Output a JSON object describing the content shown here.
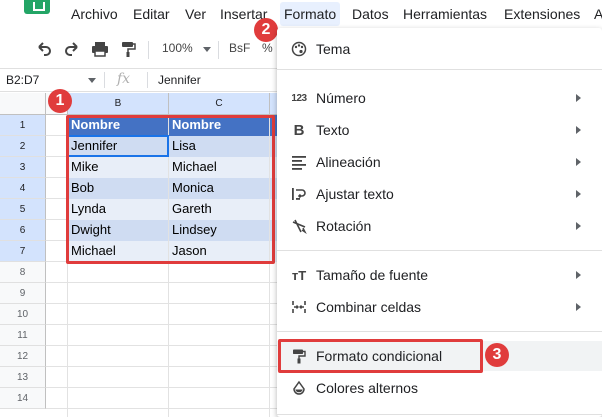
{
  "menubar": {
    "items": [
      {
        "label": "Archivo"
      },
      {
        "label": "Editar"
      },
      {
        "label": "Ver"
      },
      {
        "label": "Insertar"
      },
      {
        "label": "Formato"
      },
      {
        "label": "Datos"
      },
      {
        "label": "Herramientas"
      },
      {
        "label": "Extensiones"
      },
      {
        "label": "A"
      }
    ],
    "active_index": 4
  },
  "toolbar": {
    "zoom": "100%",
    "bsf": "BsF",
    "percent": "%",
    "icons": [
      "undo-icon",
      "redo-icon",
      "print-icon",
      "paint-format-icon"
    ]
  },
  "formula_bar": {
    "name_box": "B2:D7",
    "fx": "fx",
    "value": "Jennifer"
  },
  "grid": {
    "columns": [
      "B",
      "C"
    ],
    "rows": [
      "1",
      "2",
      "3",
      "4",
      "5",
      "6",
      "7",
      "8",
      "9",
      "10",
      "11",
      "12",
      "13",
      "14"
    ],
    "data": [
      [
        "Nombre",
        "Nombre"
      ],
      [
        "Jennifer",
        "Lisa"
      ],
      [
        "Mike",
        "Michael"
      ],
      [
        "Bob",
        "Monica"
      ],
      [
        "Lynda",
        "Gareth"
      ],
      [
        "Dwight",
        "Lindsey"
      ],
      [
        "Michael",
        "Jason"
      ]
    ],
    "header_color": "#4472c4",
    "band_dark": "#cfdcf2",
    "band_light": "#e8eef8"
  },
  "format_menu": {
    "items": [
      {
        "label": "Tema",
        "icon": "palette-icon",
        "submenu": false
      },
      {
        "label": "Número",
        "icon": "number-format-icon",
        "submenu": true
      },
      {
        "label": "Texto",
        "icon": "bold-icon",
        "submenu": true
      },
      {
        "label": "Alineación",
        "icon": "align-icon",
        "submenu": true
      },
      {
        "label": "Ajustar texto",
        "icon": "wrap-text-icon",
        "submenu": true
      },
      {
        "label": "Rotación",
        "icon": "rotate-text-icon",
        "submenu": true
      },
      {
        "label": "Tamaño de fuente",
        "icon": "font-size-icon",
        "submenu": true
      },
      {
        "label": "Combinar celdas",
        "icon": "merge-cells-icon",
        "submenu": true
      },
      {
        "label": "Formato condicional",
        "icon": "paint-roller-icon",
        "submenu": false
      },
      {
        "label": "Colores alternos",
        "icon": "fill-color-icon",
        "submenu": false
      }
    ],
    "icon_glyphs": {
      "number": "123",
      "bold": "B",
      "font_size": "тT"
    }
  },
  "markers": [
    "1",
    "2",
    "3"
  ],
  "accent": "#e03c3c"
}
